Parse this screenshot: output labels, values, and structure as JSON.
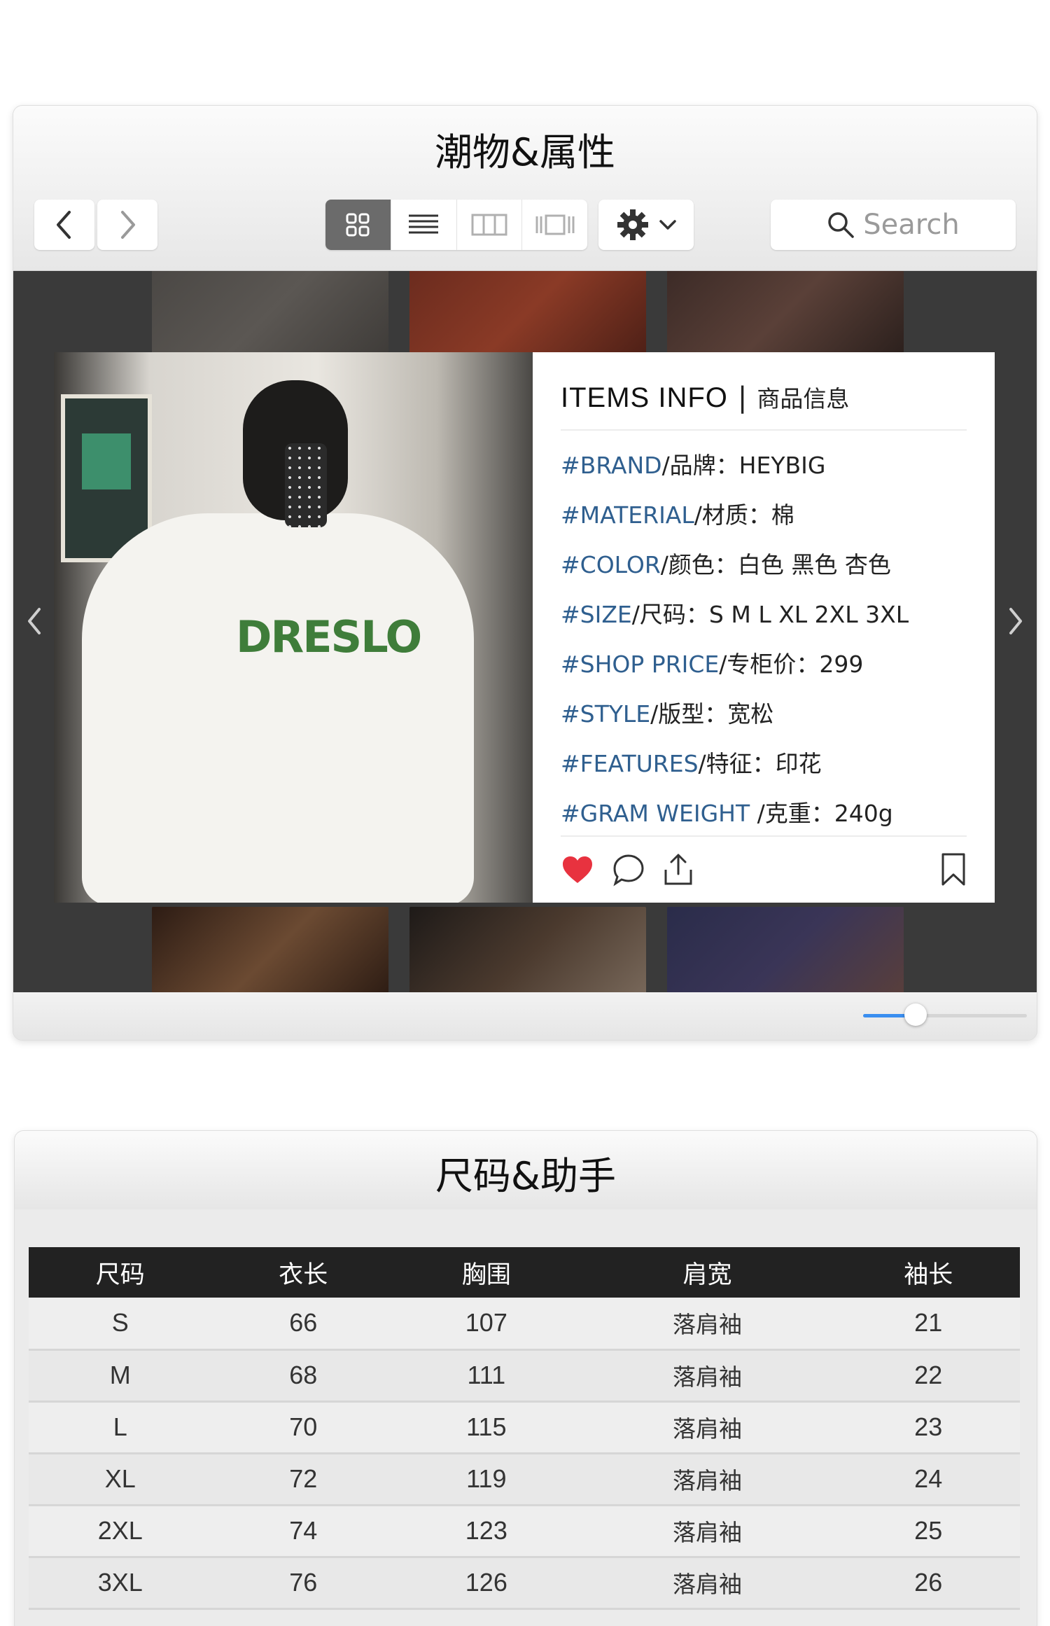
{
  "window1": {
    "title": "潮物&属性",
    "toolbar": {
      "search_placeholder": "Search",
      "icons": [
        "chevron-left-icon",
        "chevron-right-icon",
        "grid-view-icon",
        "list-view-icon",
        "column-view-icon",
        "coverflow-view-icon",
        "gear-icon",
        "chevron-down-icon",
        "search-icon"
      ],
      "active_view": "grid"
    },
    "card": {
      "photo_print": "DRESLO",
      "info_title": "ITEMS INFO",
      "info_separator": "|",
      "info_subtitle": "商品信息",
      "attributes": [
        {
          "tag": "#BRAND",
          "rest": "/品牌：HEYBIG"
        },
        {
          "tag": "#MATERIAL",
          "rest": "/材质：棉"
        },
        {
          "tag": "#COLOR",
          "rest": "/颜色：白色 黑色 杏色"
        },
        {
          "tag": "#SIZE",
          "rest": "/尺码：S M L XL 2XL 3XL"
        },
        {
          "tag": "#SHOP PRICE",
          "rest": "/专柜价：299"
        },
        {
          "tag": "#STYLE",
          "rest": "/版型：宽松"
        },
        {
          "tag": "#FEATURES",
          "rest": "/特征：印花"
        },
        {
          "tag": "#GRAM WEIGHT",
          "rest": " /克重：240g"
        }
      ],
      "actions": [
        "heart-icon",
        "comment-icon",
        "share-icon",
        "bookmark-icon"
      ]
    },
    "zoom_slider": 0.32,
    "colors": {
      "accent": "#3a8ef0",
      "tag": "#2f5f8f",
      "heart": "#e8323f",
      "stage": "#3a3a3a"
    }
  },
  "window2": {
    "title": "尺码&助手",
    "table": {
      "headers": [
        "尺码",
        "衣长",
        "胸围",
        "肩宽",
        "袖长"
      ],
      "rows": [
        [
          "S",
          "66",
          "107",
          "落肩袖",
          "21"
        ],
        [
          "M",
          "68",
          "111",
          "落肩袖",
          "22"
        ],
        [
          "L",
          "70",
          "115",
          "落肩袖",
          "23"
        ],
        [
          "XL",
          "72",
          "119",
          "落肩袖",
          "24"
        ],
        [
          "2XL",
          "74",
          "123",
          "落肩袖",
          "25"
        ],
        [
          "3XL",
          "76",
          "126",
          "落肩袖",
          "26"
        ]
      ]
    }
  }
}
